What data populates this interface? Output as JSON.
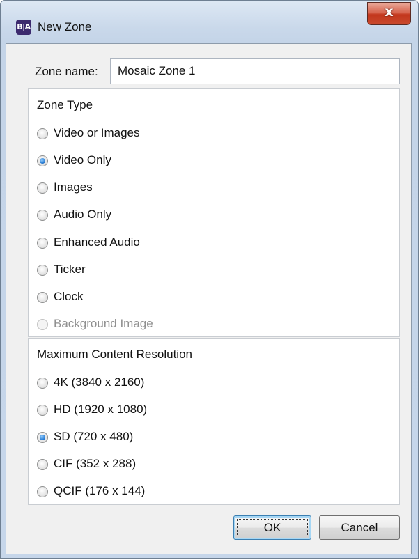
{
  "window": {
    "logo_text": "B|A",
    "title": "New Zone",
    "close_label": "x"
  },
  "form": {
    "zone_name_label": "Zone name:",
    "zone_name_value": "Mosaic Zone 1"
  },
  "zone_type": {
    "title": "Zone Type",
    "options": [
      {
        "label": "Video or Images",
        "checked": false,
        "disabled": false
      },
      {
        "label": "Video Only",
        "checked": true,
        "disabled": false
      },
      {
        "label": "Images",
        "checked": false,
        "disabled": false
      },
      {
        "label": "Audio Only",
        "checked": false,
        "disabled": false
      },
      {
        "label": "Enhanced Audio",
        "checked": false,
        "disabled": false
      },
      {
        "label": "Ticker",
        "checked": false,
        "disabled": false
      },
      {
        "label": "Clock",
        "checked": false,
        "disabled": false
      },
      {
        "label": "Background Image",
        "checked": false,
        "disabled": true
      }
    ]
  },
  "resolution": {
    "title": "Maximum Content Resolution",
    "options": [
      {
        "label": "4K (3840 x 2160)",
        "checked": false,
        "disabled": false
      },
      {
        "label": "HD (1920 x 1080)",
        "checked": false,
        "disabled": false
      },
      {
        "label": "SD (720 x 480)",
        "checked": true,
        "disabled": false
      },
      {
        "label": "CIF (352 x 288)",
        "checked": false,
        "disabled": false
      },
      {
        "label": "QCIF (176 x 144)",
        "checked": false,
        "disabled": false
      }
    ]
  },
  "buttons": {
    "ok": "OK",
    "cancel": "Cancel"
  }
}
